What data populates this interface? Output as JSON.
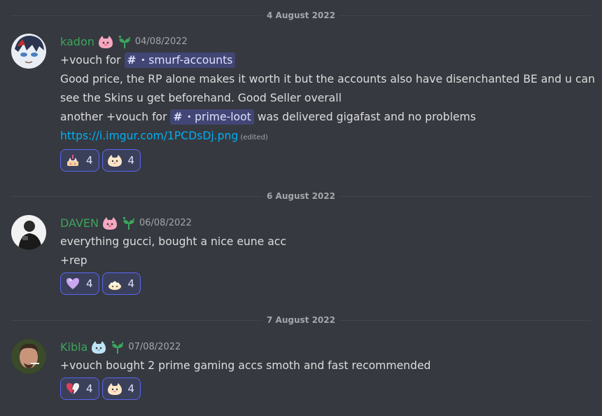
{
  "dividers": [
    "4 August 2022",
    "6 August 2022",
    "7 August 2022"
  ],
  "messages": [
    {
      "username": "kadon",
      "timestamp": "04/08/2022",
      "line1_prefix": "+vouch for ",
      "line1_channel": "・smurf-accounts",
      "line2": "Good price, the RP alone makes it worth it but the accounts also have disenchanted BE and u can see the Skins u get beforehand. Good Seller overall",
      "line3_prefix": "another +vouch for ",
      "line3_channel": "・prime-loot",
      "line3_suffix": " was delivered gigafast and no problems",
      "link": "https://i.imgur.com/1PCDsDj.png",
      "edited": "(edited)",
      "reactions": [
        {
          "emoji": "cat-cake-emoji",
          "count": "4"
        },
        {
          "emoji": "cat-face-emoji",
          "count": "4"
        }
      ]
    },
    {
      "username": "DAVEN",
      "timestamp": "06/08/2022",
      "line1": "everything gucci, bought a nice eune acc",
      "line2": "+rep",
      "reactions": [
        {
          "emoji": "purple-heart-emoji",
          "count": "4"
        },
        {
          "emoji": "cat-bun-emoji",
          "count": "4"
        }
      ]
    },
    {
      "username": "Kibla",
      "timestamp": "07/08/2022",
      "line1": "+vouch bought 2 prime gaming accs smoth and fast recommended",
      "reactions": [
        {
          "emoji": "broken-heart-emoji",
          "count": "4"
        },
        {
          "emoji": "cat-face-emoji",
          "count": "4"
        }
      ]
    }
  ],
  "colors": {
    "background": "#36393f",
    "username": "#3ba55c",
    "link": "#00aff4",
    "mention_bg": "#414675",
    "reaction_border": "#5865f2"
  }
}
